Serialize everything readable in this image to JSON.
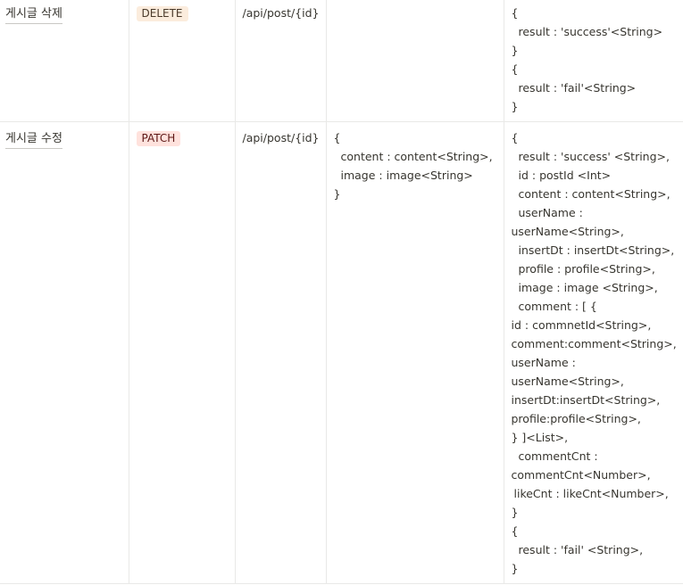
{
  "table": {
    "rows": [
      {
        "name": "게시글 삭제",
        "method": "DELETE",
        "method_bg": "#fbecdd",
        "method_fg": "#4a3a2a",
        "uri": "/api/post/{id}",
        "request": [],
        "response": [
          {
            "t": "{",
            "i": 0
          },
          {
            "t": "result : 'success'<String>",
            "i": 1
          },
          {
            "t": "}",
            "i": 0
          },
          {
            "t": "{",
            "i": 0
          },
          {
            "t": "result : 'fail'<String>",
            "i": 1
          },
          {
            "t": "}",
            "i": 0
          }
        ]
      },
      {
        "name": "게시글 수정",
        "method": "PATCH",
        "method_bg": "#ffe2dd",
        "method_fg": "#5d1715",
        "uri": "/api/post/{id}",
        "request": [
          {
            "t": "{",
            "i": 0
          },
          {
            "t": "content : content<String>,",
            "i": 1
          },
          {
            "t": "image : image<String>",
            "i": 1
          },
          {
            "t": "}",
            "i": 0
          }
        ],
        "response": [
          {
            "t": "{",
            "i": 0
          },
          {
            "t": "result : 'success' <String>,",
            "i": 1
          },
          {
            "t": "id : postId <Int>",
            "i": 1
          },
          {
            "t": "content : content<String>,",
            "i": 1
          },
          {
            "t": "userName :",
            "i": 1
          },
          {
            "t": "userName<String>,",
            "i": 0
          },
          {
            "t": "insertDt : insertDt<String>,",
            "i": 1
          },
          {
            "t": "profile : profile<String>,",
            "i": 1
          },
          {
            "t": "image : image <String>,",
            "i": 1
          },
          {
            "t": "comment : [ {",
            "i": 1
          },
          {
            "t": "id : commnetId<String>,",
            "i": 0
          },
          {
            "t": "comment:comment<String>,",
            "i": 0
          },
          {
            "t": "userName :",
            "i": 0
          },
          {
            "t": "userName<String>,",
            "i": 0
          },
          {
            "t": "insertDt:insertDt<String>,",
            "i": 0
          },
          {
            "t": "profile:profile<String>,",
            "i": 0
          },
          {
            "t": "} ]<List>,",
            "i": 0
          },
          {
            "t": "commentCnt :",
            "i": 1
          },
          {
            "t": "commentCnt<Number>,",
            "i": 0
          },
          {
            "t": "likeCnt : likeCnt<Number>,",
            "i": 2
          },
          {
            "t": "}",
            "i": 0
          },
          {
            "t": "{",
            "i": 0
          },
          {
            "t": "result : 'fail' <String>,",
            "i": 1
          },
          {
            "t": "}",
            "i": 0
          }
        ]
      }
    ]
  }
}
